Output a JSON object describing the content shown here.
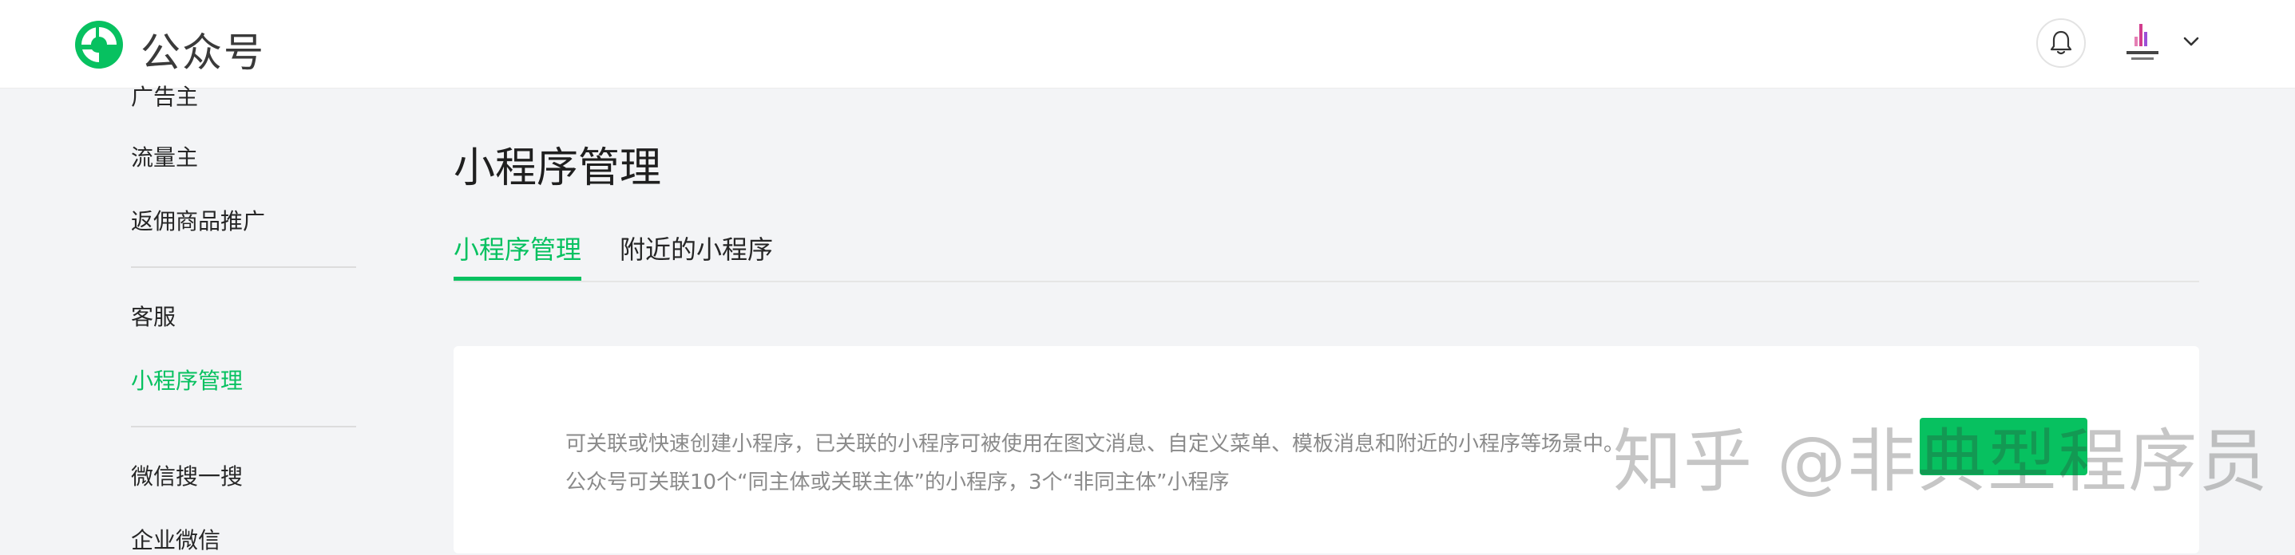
{
  "header": {
    "brand": "公众号",
    "colors": {
      "accent": "#07c160"
    }
  },
  "sidebar": {
    "items": [
      {
        "label": "广告主",
        "active": false
      },
      {
        "label": "流量主",
        "active": false
      },
      {
        "label": "返佣商品推广",
        "active": false
      },
      {
        "label": "客服",
        "active": false
      },
      {
        "label": "小程序管理",
        "active": true
      },
      {
        "label": "微信搜一搜",
        "active": false
      },
      {
        "label": "企业微信",
        "active": false
      }
    ]
  },
  "main": {
    "title": "小程序管理",
    "tabs": [
      {
        "label": "小程序管理",
        "active": true
      },
      {
        "label": "附近的小程序",
        "active": false
      }
    ],
    "description": [
      "可关联或快速创建小程序，已关联的小程序可被使用在图文消息、自定义菜单、模板消息和附近的小程序等场景中。",
      "公众号可关联10个“同主体或关联主体”的小程序，3个“非同主体”小程序"
    ]
  },
  "watermark": "知乎 @非典型程序员"
}
